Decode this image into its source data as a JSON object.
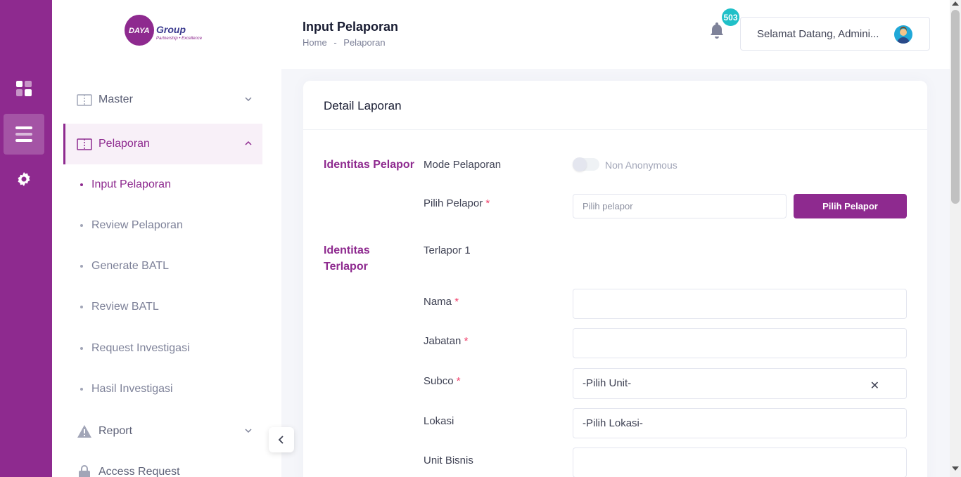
{
  "brand": {
    "logo_text": "DAYA Group",
    "logo_tagline": "Partnership • Excellence",
    "color": "#8e2a8f"
  },
  "rail": {
    "items": [
      {
        "icon": "dashboard-icon"
      },
      {
        "icon": "menu-list-icon",
        "active": true
      },
      {
        "icon": "gear-icon"
      }
    ]
  },
  "sidebar": {
    "master": {
      "label": "Master"
    },
    "pelaporan": {
      "label": "Pelaporan"
    },
    "sub_items": [
      {
        "label": "Input Pelaporan",
        "active": true
      },
      {
        "label": "Review Pelaporan"
      },
      {
        "label": "Generate BATL"
      },
      {
        "label": "Review BATL"
      },
      {
        "label": "Request Investigasi"
      },
      {
        "label": "Hasil Investigasi"
      }
    ],
    "report": {
      "label": "Report"
    },
    "access_request": {
      "label": "Access Request"
    }
  },
  "header": {
    "title": "Input Pelaporan",
    "breadcrumb": [
      "Home",
      "-",
      "Pelaporan"
    ],
    "notification_count": "503",
    "user_greeting": "Selamat Datang, Admini..."
  },
  "card": {
    "title": "Detail Laporan",
    "sections": {
      "pelapor": "Identitas Pelapor",
      "terlapor_line1": "Identitas",
      "terlapor_line2": "Terlapor"
    },
    "fields": {
      "mode_label": "Mode Pelaporan",
      "mode_value": "Non Anonymous",
      "pilih_pelapor_label": "Pilih Pelapor",
      "pilih_pelapor_placeholder": "Pilih pelapor",
      "pilih_pelapor_button": "Pilih Pelapor",
      "terlapor_header": "Terlapor 1",
      "nama_label": "Nama",
      "jabatan_label": "Jabatan",
      "subco_label": "Subco",
      "subco_value": "-Pilih Unit-",
      "lokasi_label": "Lokasi",
      "lokasi_value": "-Pilih Lokasi-",
      "unit_bisnis_label": "Unit Bisnis",
      "required_mark": "*"
    }
  }
}
